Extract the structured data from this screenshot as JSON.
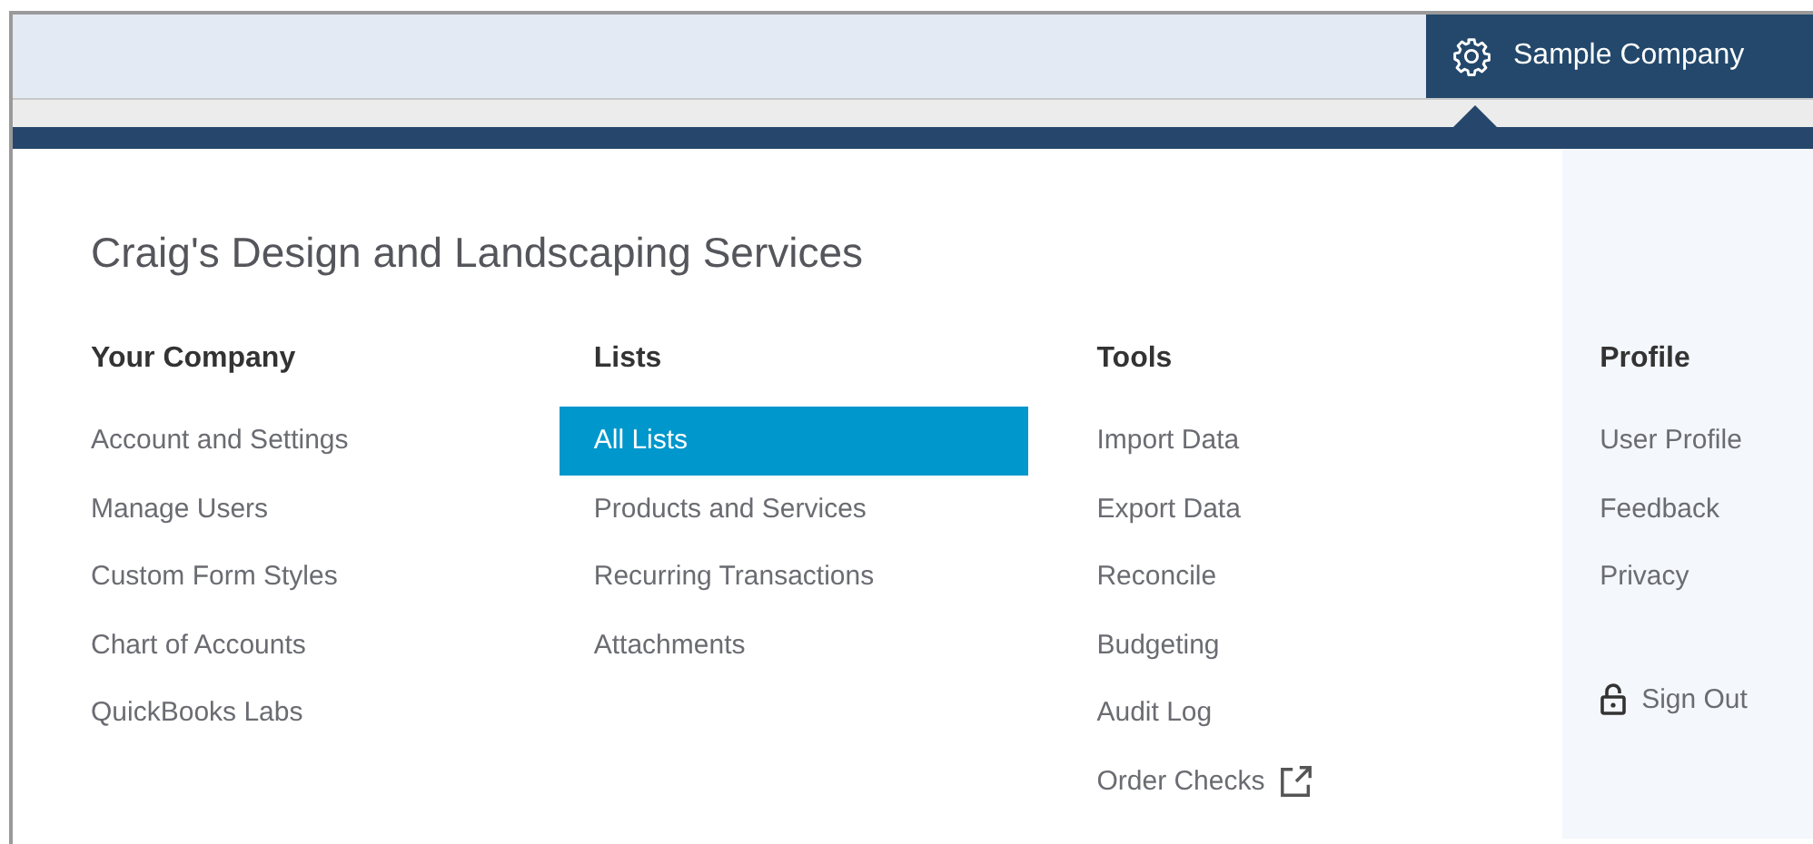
{
  "company_button": {
    "label": "Sample Company"
  },
  "company_name": "Craig's Design and Landscaping Services",
  "columns": [
    {
      "heading": "Your Company",
      "shaded": false,
      "items": [
        {
          "label": "Account and Settings",
          "selected": false,
          "kind": "link"
        },
        {
          "label": "Manage Users",
          "selected": false,
          "kind": "link"
        },
        {
          "label": "Custom Form Styles",
          "selected": false,
          "kind": "link"
        },
        {
          "label": "Chart of Accounts",
          "selected": false,
          "kind": "link"
        },
        {
          "label": "QuickBooks Labs",
          "selected": false,
          "kind": "link"
        }
      ]
    },
    {
      "heading": "Lists",
      "shaded": false,
      "items": [
        {
          "label": "All Lists",
          "selected": true,
          "kind": "link"
        },
        {
          "label": "Products and Services",
          "selected": false,
          "kind": "link"
        },
        {
          "label": "Recurring Transactions",
          "selected": false,
          "kind": "link"
        },
        {
          "label": "Attachments",
          "selected": false,
          "kind": "link"
        }
      ]
    },
    {
      "heading": "Tools",
      "shaded": false,
      "items": [
        {
          "label": "Import Data",
          "selected": false,
          "kind": "link"
        },
        {
          "label": "Export Data",
          "selected": false,
          "kind": "link"
        },
        {
          "label": "Reconcile",
          "selected": false,
          "kind": "link"
        },
        {
          "label": "Budgeting",
          "selected": false,
          "kind": "link"
        },
        {
          "label": "Audit Log",
          "selected": false,
          "kind": "link"
        },
        {
          "label": "Order Checks",
          "selected": false,
          "kind": "external"
        }
      ]
    },
    {
      "heading": "Profile",
      "shaded": true,
      "items": [
        {
          "label": "User Profile",
          "selected": false,
          "kind": "link"
        },
        {
          "label": "Feedback",
          "selected": false,
          "kind": "link"
        },
        {
          "label": "Privacy",
          "selected": false,
          "kind": "link"
        },
        {
          "label": "Sign Out",
          "selected": false,
          "kind": "sign-out"
        }
      ]
    }
  ]
}
